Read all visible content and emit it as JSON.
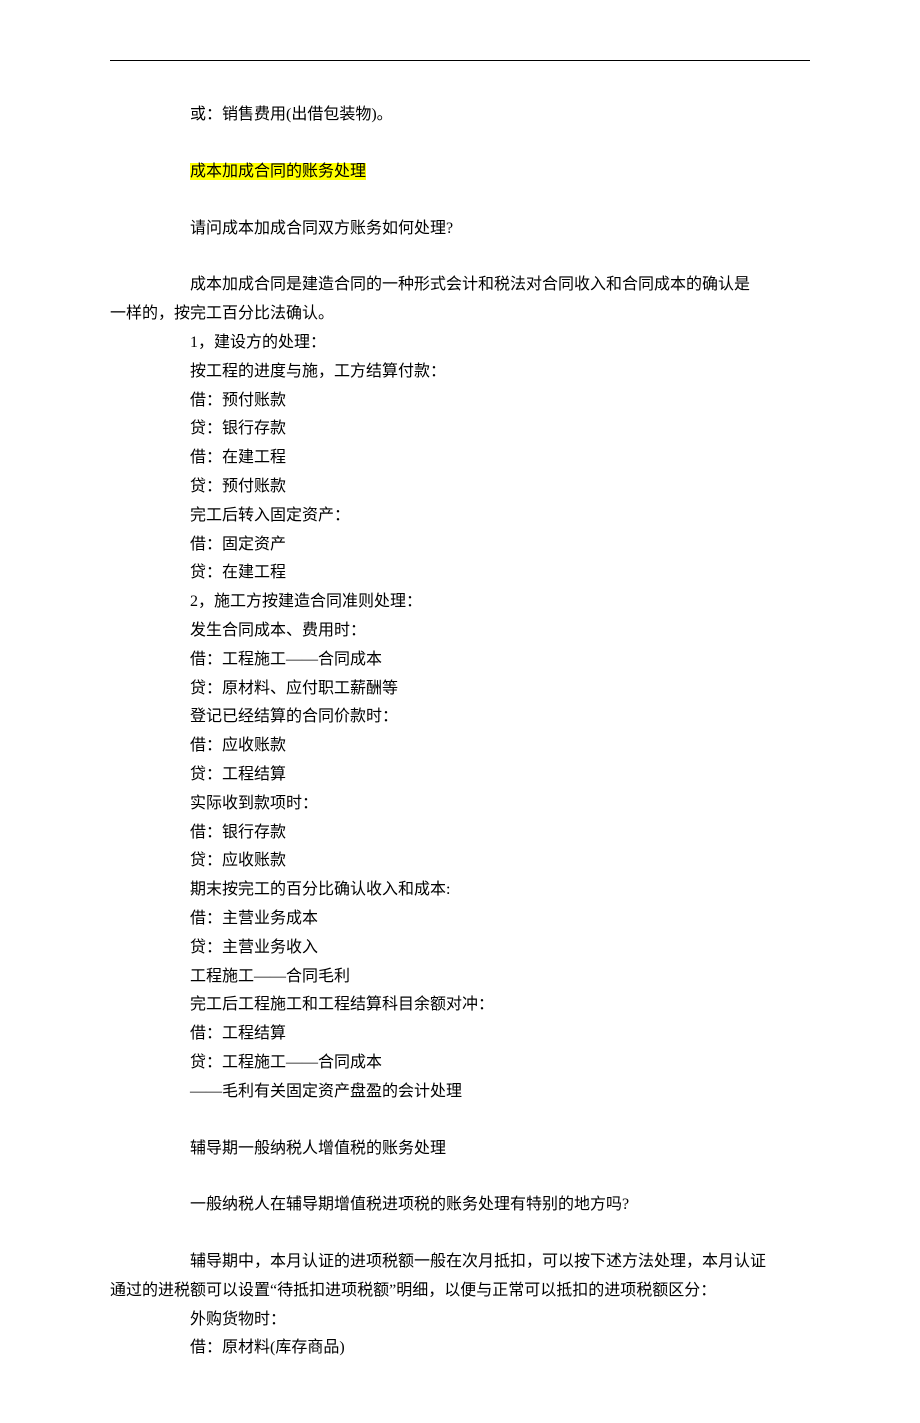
{
  "top_line": "或：销售费用(出借包装物)。",
  "section1_title": "成本加成合同的账务处理",
  "section1_q": "请问成本加成合同双方账务如何处理?",
  "section1_intro_a": "成本加成合同是建造合同的一种形式会计和税法对合同收入和合同成本的确认是",
  "section1_intro_b": "一样的，按完工百分比法确认。",
  "lines": [
    "1，建设方的处理：",
    "按工程的进度与施，工方结算付款：",
    "借：预付账款",
    "贷：银行存款",
    "借：在建工程",
    "贷：预付账款",
    "完工后转入固定资产：",
    "借：固定资产",
    "贷：在建工程",
    "2，施工方按建造合同准则处理：",
    "发生合同成本、费用时：",
    "借：工程施工——合同成本",
    "贷：原材料、应付职工薪酬等",
    "登记已经结算的合同价款时：",
    "借：应收账款",
    "贷：工程结算",
    "实际收到款项时：",
    "借：银行存款",
    "贷：应收账款",
    "期末按完工的百分比确认收入和成本:",
    "借：主营业务成本",
    "贷：主营业务收入",
    "工程施工——合同毛利",
    "完工后工程施工和工程结算科目余额对冲：",
    "借：工程结算",
    "贷：工程施工——合同成本",
    "——毛利有关固定资产盘盈的会计处理"
  ],
  "section2_title": "辅导期一般纳税人增值税的账务处理",
  "section2_q": "一般纳税人在辅导期增值税进项税的账务处理有特别的地方吗?",
  "section2_p1_a": "辅导期中，本月认证的进项税额一般在次月抵扣，可以按下述方法处理，本月认证",
  "section2_p1_b": "通过的进税额可以设置“待抵扣进项税额”明细，以便与正常可以抵扣的进项税额区分：",
  "tail_lines": [
    "外购货物时：",
    "借：原材料(库存商品)"
  ]
}
